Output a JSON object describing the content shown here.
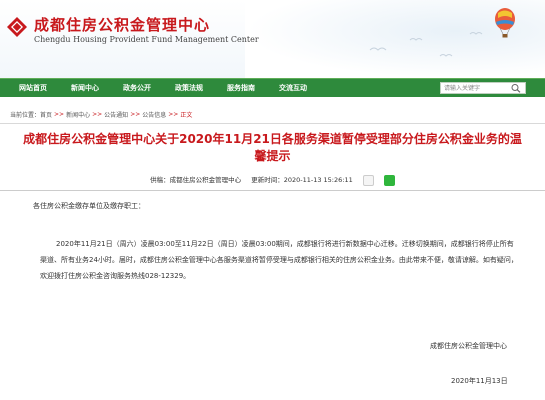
{
  "header": {
    "title": "成都住房公积金管理中心",
    "subtitle": "Chengdu Housing Provident Fund Management Center"
  },
  "nav": {
    "items": [
      "网站首页",
      "新闻中心",
      "政务公开",
      "政策法规",
      "服务指南",
      "交流互动"
    ],
    "search_placeholder": "请输入关键字"
  },
  "breadcrumb": {
    "prefix": "当前位置：",
    "items": [
      "首页",
      "新闻中心",
      "公告通知",
      "公告信息",
      "正文"
    ],
    "separator": ">>"
  },
  "article": {
    "title": "成都住房公积金管理中心关于2020年11月21日各服务渠道暂停受理部分住房公积金业务的温馨提示",
    "source_label": "供稿：",
    "source": "成都住房公积金管理中心",
    "time_label": "更新时间：",
    "time": "2020-11-13 15:26:11",
    "greeting": "各住房公积金缴存单位及缴存职工：",
    "body": "2020年11月21日（周六）凌晨03:00至11月22日（周日）凌晨03:00期间，成都银行将进行新数据中心迁移。迁移切换期间，成都银行将停止所有渠道、所有业务24小时。届时，成都住房公积金管理中心各服务渠道将暂停受理与成都银行相关的住房公积金业务。由此带来不便，敬请谅解。如有疑问，欢迎拨打住房公积金咨询服务热线028-12329。",
    "signature": "成都住房公积金管理中心",
    "date": "2020年11月13日"
  },
  "icons": {
    "logo": "logo-icon",
    "balloon": "balloon-icon",
    "weibo": "weibo-icon",
    "wechat": "wechat-icon",
    "search": "search-icon"
  },
  "colors": {
    "brand_red": "#c8191d",
    "nav_green": "#2e8a3c"
  }
}
